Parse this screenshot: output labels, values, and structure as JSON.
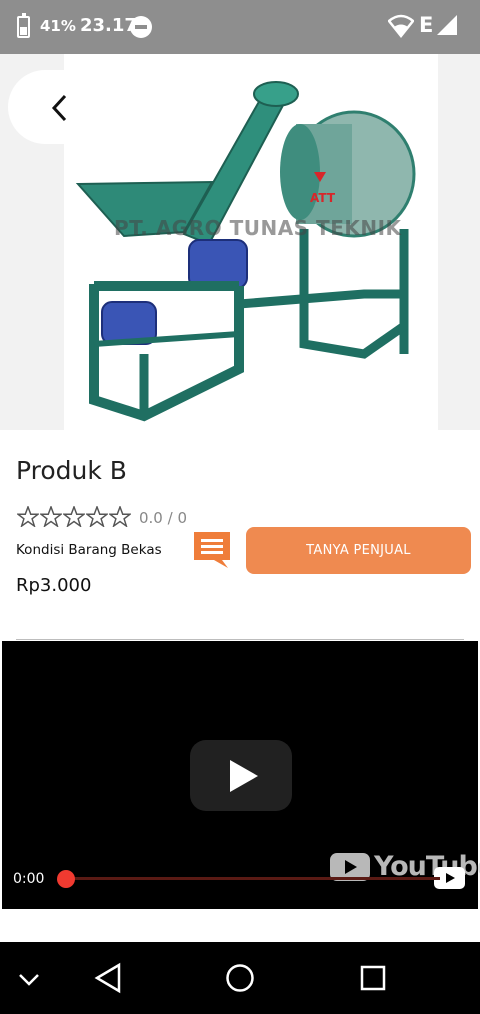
{
  "status_bar": {
    "battery_percent": "41%",
    "time": "23.17",
    "network_type": "E",
    "icons": [
      "battery-icon",
      "do-not-disturb-icon",
      "wifi-icon",
      "signal-icon"
    ]
  },
  "product": {
    "image_watermark": "PT. AGRO TUNAS TEKNIK",
    "name": "Produk B",
    "rating_text": "0.0 / 0",
    "star_count": 5,
    "filled_stars": 0,
    "condition": "Kondisi Barang Bekas",
    "price": "Rp3.000"
  },
  "actions": {
    "chat_icon": "chat-icon",
    "ask_seller_label": "TANYA PENJUAL",
    "accent_color": "#ef8a50"
  },
  "video": {
    "current_time": "0:00",
    "logo_text": "YouTube",
    "progress": 0
  },
  "nav_bar": {
    "icons": [
      "chevron-down-icon",
      "back-triangle-icon",
      "home-circle-icon",
      "recents-square-icon"
    ]
  }
}
